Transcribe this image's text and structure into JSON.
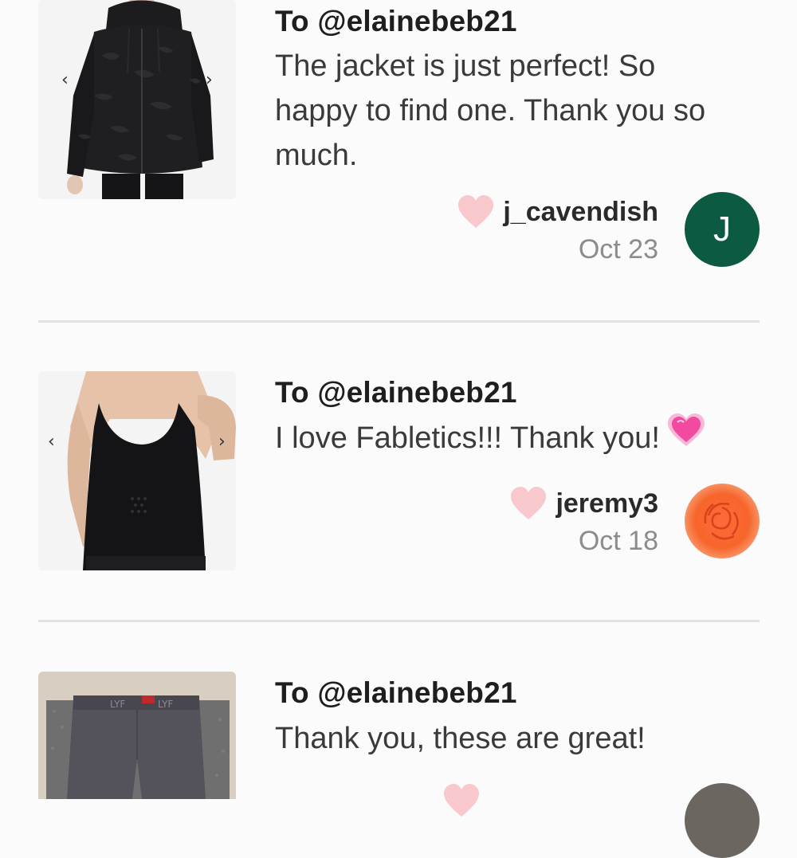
{
  "feed": {
    "posts": [
      {
        "to": "To @elainebeb21",
        "message": "The jacket is just perfect! So happy to find one. Thank you so much.",
        "username": "j_cavendish",
        "date": "Oct 23",
        "avatar_letter": "J",
        "avatar_color": "#0d5a43",
        "image": "black-camo-zip-hoodie"
      },
      {
        "to": "To @elainebeb21",
        "message": "I love Fabletics!!! Thank you!",
        "message_emoji": "heart-sparkle-emoji",
        "username": "jeremy3",
        "date": "Oct 18",
        "avatar": "rose-photo",
        "image": "black-racerback-tank"
      },
      {
        "to": "To @elainebeb21",
        "message": "Thank you, these are great!",
        "image": "grey-shorts-flatlay"
      }
    ]
  },
  "colors": {
    "heart": "#f8c8cc",
    "accent_avatar": "#0d5a43",
    "divider": "#e2e2e2",
    "date": "#8c8c8c"
  }
}
